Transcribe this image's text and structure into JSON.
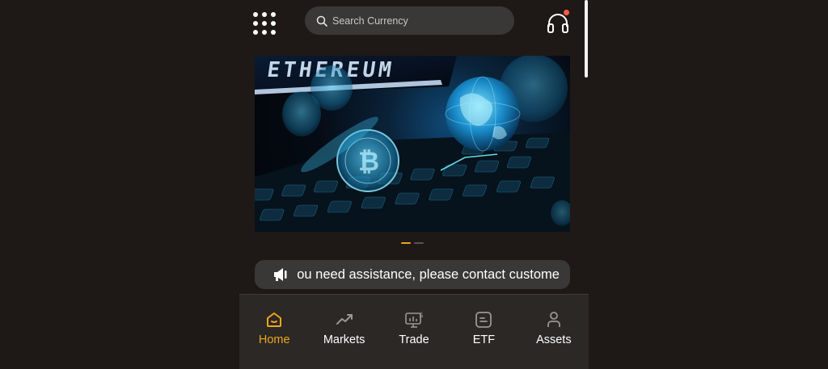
{
  "header": {
    "menu_icon": "apps-grid-icon",
    "search": {
      "placeholder": "Search Currency",
      "value": "",
      "icon": "search-icon"
    },
    "support_icon": "headset-icon",
    "support_badge": true
  },
  "banner": {
    "image_text": "ETHEREUM",
    "slide_count": 2,
    "active_slide": 0
  },
  "notice": {
    "icon": "megaphone-icon",
    "text": "you need assistance, please contact custome"
  },
  "tabbar": {
    "items": [
      {
        "label": "Home",
        "icon": "home-icon",
        "active": true
      },
      {
        "label": "Markets",
        "icon": "trend-up-icon",
        "active": false
      },
      {
        "label": "Trade",
        "icon": "trade-monitor-icon",
        "active": false
      },
      {
        "label": "ETF",
        "icon": "etf-icon",
        "active": false
      },
      {
        "label": "Assets",
        "icon": "user-icon",
        "active": false
      }
    ]
  },
  "colors": {
    "background": "#1e1917",
    "surface": "#3a3836",
    "tabbar": "#2b2826",
    "accent": "#f0a61a",
    "badge": "#ff5b4d"
  }
}
